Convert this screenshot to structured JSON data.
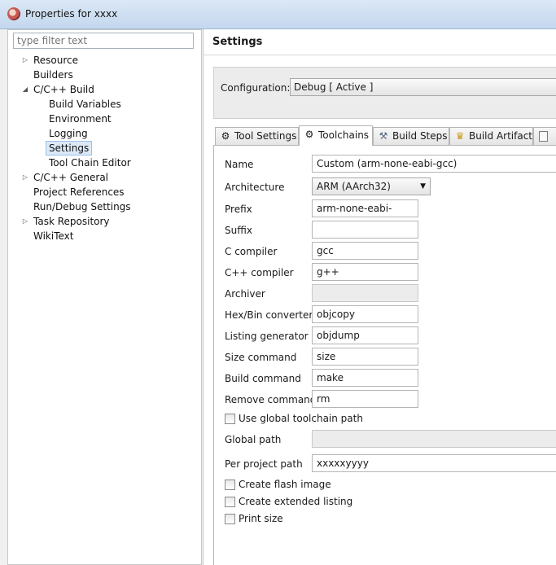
{
  "window": {
    "title": "Properties for xxxx"
  },
  "left": {
    "filter_placeholder": "type filter text",
    "tree": [
      {
        "label": "Resource",
        "level": 0,
        "arrow": "collapsed"
      },
      {
        "label": "Builders",
        "level": 0
      },
      {
        "label": "C/C++ Build",
        "level": 0,
        "arrow": "expanded"
      },
      {
        "label": "Build Variables",
        "level": 1
      },
      {
        "label": "Environment",
        "level": 1
      },
      {
        "label": "Logging",
        "level": 1
      },
      {
        "label": "Settings",
        "level": 1,
        "selected": true
      },
      {
        "label": "Tool Chain Editor",
        "level": 1
      },
      {
        "label": "C/C++ General",
        "level": 0,
        "arrow": "collapsed"
      },
      {
        "label": "Project References",
        "level": 0
      },
      {
        "label": "Run/Debug Settings",
        "level": 0
      },
      {
        "label": "Task Repository",
        "level": 0,
        "arrow": "collapsed"
      },
      {
        "label": "WikiText",
        "level": 0
      }
    ]
  },
  "right": {
    "title": "Settings",
    "config_label": "Configuration:",
    "config_value": "Debug  [ Active ]",
    "tabs": [
      {
        "label": "Tool Settings",
        "icon": "gear-icon"
      },
      {
        "label": "Toolchains",
        "icon": "gear-icon",
        "active": true
      },
      {
        "label": "Build Steps",
        "icon": "hammer-icon"
      },
      {
        "label": "Build Artifact",
        "icon": "trophy-icon"
      }
    ]
  },
  "toolchains": {
    "name_label": "Name",
    "name_value": "Custom (arm-none-eabi-gcc)",
    "arch_label": "Architecture",
    "arch_value": "ARM (AArch32)",
    "prefix_label": "Prefix",
    "prefix_value": "arm-none-eabi-",
    "suffix_label": "Suffix",
    "suffix_value": "",
    "c_label": "C compiler",
    "c_value": "gcc",
    "cpp_label": "C++ compiler",
    "cpp_value": "g++",
    "archiver_label": "Archiver",
    "archiver_value": "",
    "hexbin_label": "Hex/Bin converter",
    "hexbin_value": "objcopy",
    "listing_label": "Listing generator",
    "listing_value": "objdump",
    "size_label": "Size command",
    "size_value": "size",
    "build_label": "Build command",
    "build_value": "make",
    "remove_label": "Remove command",
    "remove_value": "rm",
    "use_global_label": "Use global toolchain path",
    "global_path_label": "Global path",
    "global_path_value": "",
    "per_project_label": "Per project path",
    "per_project_value": "xxxxxyyyy",
    "flash_label": "Create flash image",
    "ext_listing_label": "Create extended listing",
    "print_size_label": "Print size"
  }
}
